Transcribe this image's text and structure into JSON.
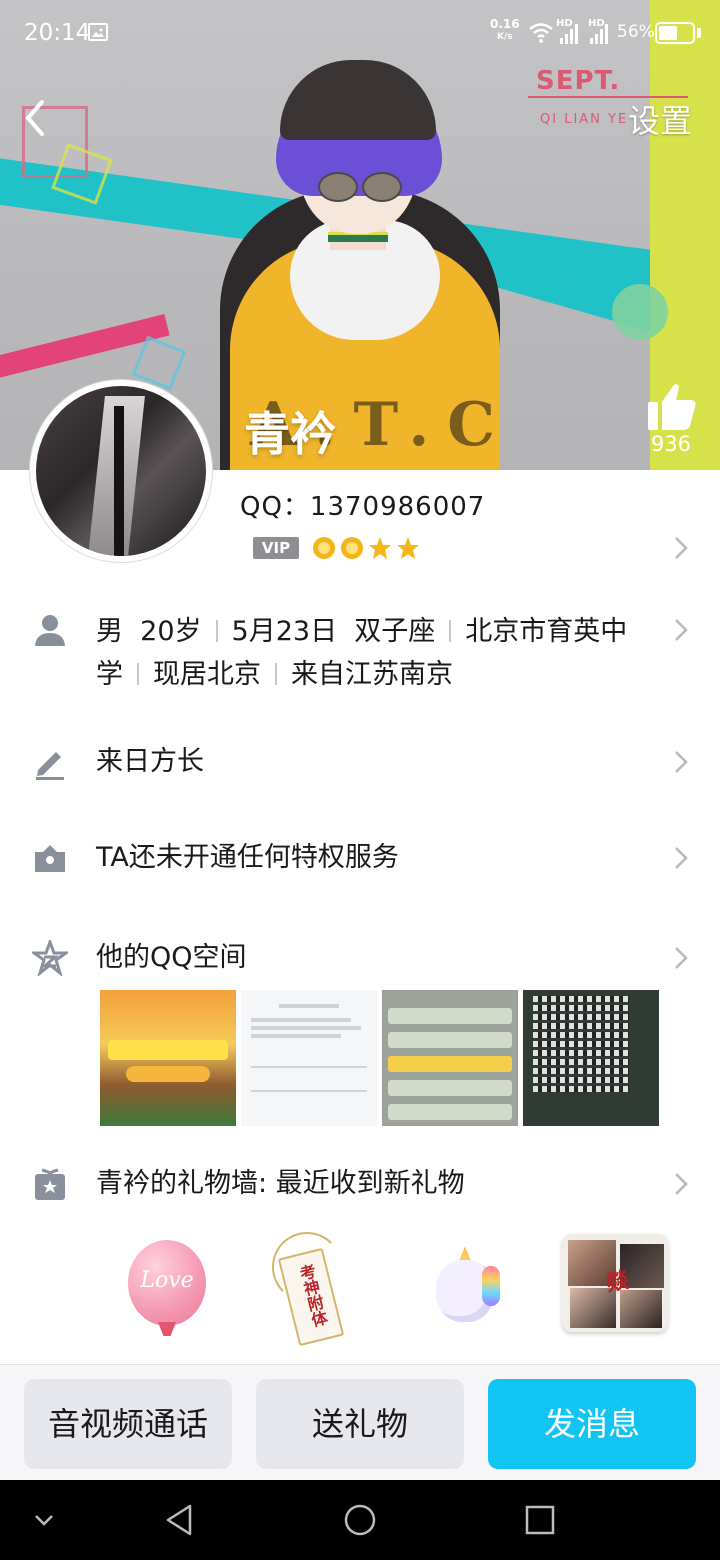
{
  "status_bar": {
    "time": "20:14",
    "net_speed_value": "0.16",
    "net_speed_unit": "K/s",
    "hd1": "HD",
    "hd2": "HD",
    "battery_pct": "56%",
    "battery_level": 0.56
  },
  "header": {
    "settings_label": "设置",
    "sept_label": "SEPT.",
    "qilian_label": "QI LIAN YE",
    "nickname": "青衿",
    "like_count": "936",
    "shirt_letters": "A.T.C"
  },
  "profile": {
    "qq_line": "QQ：1370986007",
    "vip_label": "VIP",
    "level_icons": [
      "sun-icon",
      "sun-icon",
      "star-icon",
      "star-icon"
    ]
  },
  "info": {
    "gender": "男",
    "age": "20岁",
    "birthday": "5月23日",
    "zodiac": "双子座",
    "school_part1": "北京市育英中",
    "school_part2": "学",
    "residence": "现居北京",
    "hometown": "来自江苏南京"
  },
  "rows": {
    "signature": "来日方长",
    "privilege": "TA还未开通任何特权服务",
    "qzone": "他的QQ空间",
    "gift_wall": "青衿的礼物墙: 最近收到新礼物"
  },
  "gifts": {
    "balloon_text": "Love",
    "tag_text": "考神附体",
    "pillow_text": "燚"
  },
  "actions": {
    "call": "音视频通话",
    "gift": "送礼物",
    "message": "发消息"
  },
  "colors": {
    "accent": "#12c4f2",
    "icon_gray": "#8a8f9c",
    "chevron": "#b8b8bd"
  }
}
